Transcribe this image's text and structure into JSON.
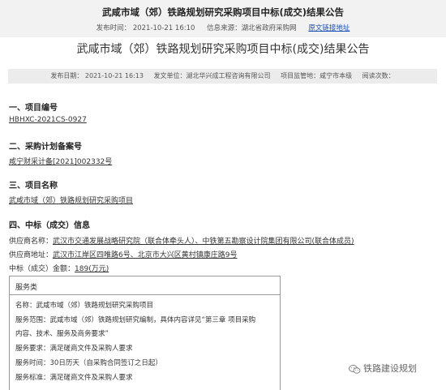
{
  "header": {
    "title": "武咸市域（郊）铁路规划研究采购项目中标(成交)结果公告",
    "publish_time": "发布时间： 2021-10-21 16:10",
    "source": "信息来源：湖北省政府采购网",
    "original_link": "原文链接地址"
  },
  "main_title": "武咸市域（郊）铁路规划研究采购项目中标(成交)结果公告",
  "info_bar": {
    "publish_date": "发布日期： 2021-10-21 16:13",
    "publisher": "发文单位：湖北华兴成工程咨询有限公司",
    "authority": "项目监管地：咸宁市本级",
    "views": "阅读次数："
  },
  "sections": {
    "s1_title": "一、项目编号",
    "s1_value": "HBHXC-2021CS-0927",
    "s2_title": "二、采购计划备案号",
    "s2_value": "咸宁财采计备[2021]002332号",
    "s3_title": "三、项目名称",
    "s3_value": "武咸市域（郊）铁路规划研究采购项目",
    "s4_title": "四、中标（成交）信息"
  },
  "winner": {
    "name_label": "供应商名称：",
    "name_value": "武汉市交通发展战略研究院（联合体牵头人）、中铁第五勘察设计院集团有限公司(联合体成员)",
    "addr_label": "供应商地址：",
    "addr_value": "武汉市江岸区四唯路6号、北京市大兴区黄村镇康庄路9号",
    "amount_label": "中标（成交）金额：",
    "amount_value": "189(万元)"
  },
  "service_box": {
    "header": "服务类",
    "name": "名称：武咸市域（郊）铁路规划研究采购项目",
    "scope_1": "服务范围：武咸市域（郊）铁路规划研究编制，具体内容详见“第三章 项目采购",
    "scope_2": "内容、技术、服务及商务要求”",
    "requirement": "服务要求：满足磋商文件及采购人要求",
    "duration": "服务时间：30日历天（自采购合同签订之日起）",
    "standard": "服务标准：满足磋商文件及采购人要求"
  },
  "watermark": {
    "text": "铁路建设规划",
    "icon": "wechat-icon"
  }
}
